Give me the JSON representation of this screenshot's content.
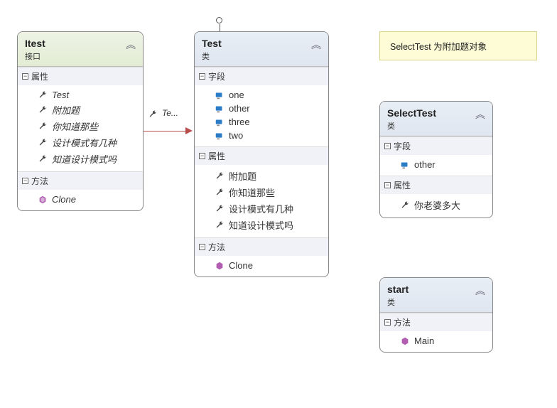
{
  "note": {
    "text": "SelectTest 为附加题对象"
  },
  "itest": {
    "name": "Itest",
    "stereo": "接口",
    "sections": {
      "attrs": {
        "label": "属性",
        "items": [
          "Test",
          "附加题",
          "你知道那些",
          "设计模式有几种",
          "知道设计模式吗"
        ]
      },
      "methods": {
        "label": "方法",
        "items": [
          "Clone"
        ]
      }
    }
  },
  "test": {
    "name": "Test",
    "stereo": "类",
    "sections": {
      "fields": {
        "label": "字段",
        "items": [
          "one",
          "other",
          "three",
          "two"
        ]
      },
      "attrs": {
        "label": "属性",
        "items": [
          "附加题",
          "你知道那些",
          "设计模式有几种",
          "知道设计模式吗"
        ]
      },
      "methods": {
        "label": "方法",
        "items": [
          "Clone"
        ]
      }
    }
  },
  "selecttest": {
    "name": "SelectTest",
    "stereo": "类",
    "sections": {
      "fields": {
        "label": "字段",
        "items": [
          "other"
        ]
      },
      "attrs": {
        "label": "属性",
        "items": [
          "你老婆多大"
        ]
      }
    }
  },
  "start": {
    "name": "start",
    "stereo": "类",
    "sections": {
      "methods": {
        "label": "方法",
        "items": [
          "Main"
        ]
      }
    }
  },
  "relations": {
    "itest_to_test": {
      "label": "Te..."
    }
  },
  "icons": {
    "chevron_up": "︽",
    "minus": "−"
  }
}
